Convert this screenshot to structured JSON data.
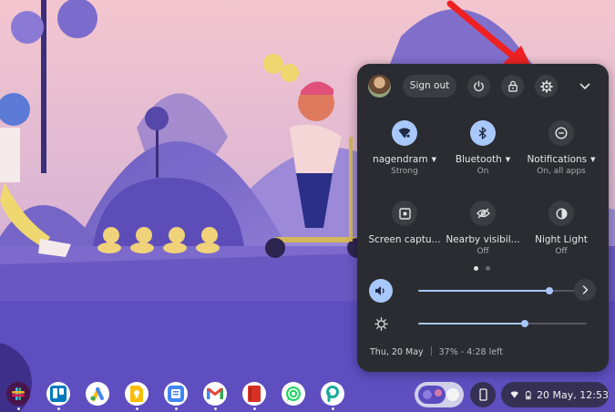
{
  "colors": {
    "panel_bg": "#2b2c31",
    "accent": "#a8c7fa",
    "button_bg": "#3c3d43"
  },
  "quick_settings": {
    "header": {
      "sign_out_label": "Sign out",
      "power_icon": "power-icon",
      "lock_icon": "lock-icon",
      "settings_icon": "gear-icon",
      "collapse_icon": "chevron-down-icon"
    },
    "tiles": [
      {
        "label": "nagendram",
        "sub": "Strong",
        "icon": "wifi-icon",
        "on": true,
        "has_menu": true
      },
      {
        "label": "Bluetooth",
        "sub": "On",
        "icon": "bluetooth-icon",
        "on": true,
        "has_menu": true
      },
      {
        "label": "Notifications",
        "sub": "On, all apps",
        "icon": "do-not-disturb-icon",
        "on": false,
        "has_menu": true
      },
      {
        "label": "Screen captu...",
        "sub": "",
        "icon": "screen-capture-icon",
        "on": false,
        "has_menu": false
      },
      {
        "label": "Nearby visibil...",
        "sub": "Off",
        "icon": "nearby-share-icon",
        "on": false,
        "has_menu": false
      },
      {
        "label": "Night Light",
        "sub": "Off",
        "icon": "night-light-icon",
        "on": false,
        "has_menu": false
      }
    ],
    "page_indicator": {
      "current": 1,
      "total": 2
    },
    "volume": {
      "level": 0.78,
      "icon": "volume-icon"
    },
    "brightness": {
      "level": 0.63,
      "icon": "brightness-icon"
    },
    "footer": {
      "date": "Thu, 20 May",
      "battery": "37% - 4:28 left"
    }
  },
  "shelf": {
    "apps": [
      {
        "name": "Slack",
        "icon": "slack-icon",
        "bg": "#4a154b"
      },
      {
        "name": "Trello",
        "icon": "trello-icon",
        "bg": "#ffffff"
      },
      {
        "name": "Google Ads",
        "icon": "google-ads-icon",
        "bg": "#ffffff"
      },
      {
        "name": "Google Keep",
        "icon": "keep-icon",
        "bg": "#ffffff"
      },
      {
        "name": "Google Docs",
        "icon": "docs-icon",
        "bg": "#ffffff"
      },
      {
        "name": "Gmail",
        "icon": "gmail-icon",
        "bg": "#ffffff"
      },
      {
        "name": "Book",
        "icon": "book-icon",
        "bg": "#ffffff"
      },
      {
        "name": "WhatsApp",
        "icon": "whatsapp-icon",
        "bg": "#ffffff"
      },
      {
        "name": "Picsart",
        "icon": "picsart-icon",
        "bg": "#ffffff"
      }
    ],
    "status": {
      "date_time": "20 May, 12:53"
    }
  }
}
